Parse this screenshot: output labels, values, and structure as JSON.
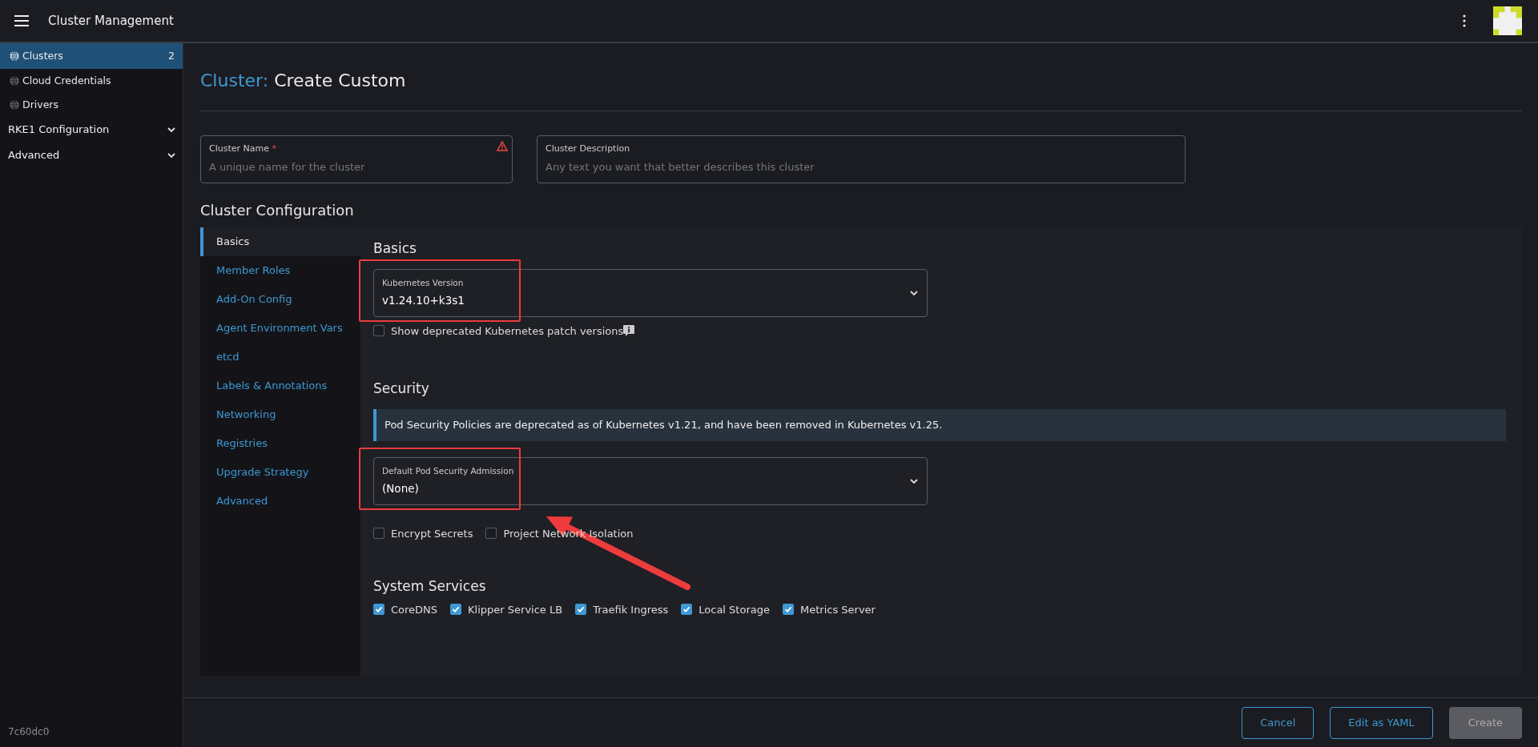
{
  "header": {
    "title": "Cluster Management"
  },
  "sidebar": {
    "items": [
      {
        "kind": "link",
        "label": "Clusters",
        "count": "2",
        "selected": true
      },
      {
        "kind": "link",
        "label": "Cloud Credentials",
        "selected": false
      },
      {
        "kind": "link",
        "label": "Drivers",
        "selected": false
      },
      {
        "kind": "group",
        "label": "RKE1 Configuration",
        "expanded": false
      },
      {
        "kind": "group",
        "label": "Advanced",
        "expanded": false
      }
    ],
    "version": "7c60dc0"
  },
  "page": {
    "title_prefix": "Cluster:",
    "title": "Create Custom"
  },
  "fields": [
    {
      "label": "Cluster Name",
      "required_mark": "*",
      "error": true,
      "placeholder": "A unique name for the cluster"
    },
    {
      "label": "Cluster Description",
      "error": false,
      "placeholder": "Any text you want that better describes this cluster"
    }
  ],
  "config": {
    "heading": "Cluster Configuration",
    "tabs": [
      {
        "label": "Basics",
        "selected": true
      },
      {
        "label": "Member Roles",
        "selected": false
      },
      {
        "label": "Add-On Config",
        "selected": false
      },
      {
        "label": "Agent Environment Vars",
        "selected": false
      },
      {
        "label": "etcd",
        "selected": false
      },
      {
        "label": "Labels & Annotations",
        "selected": false
      },
      {
        "label": "Networking",
        "selected": false
      },
      {
        "label": "Registries",
        "selected": false
      },
      {
        "label": "Upgrade Strategy",
        "selected": false
      },
      {
        "label": "Advanced",
        "selected": false
      }
    ],
    "basics": {
      "heading": "Basics",
      "version_select": {
        "label": "Kubernetes Version",
        "value": "v1.24.10+k3s1",
        "highlighted": true
      },
      "show_deprecated": {
        "label": "Show deprecated Kubernetes patch versions",
        "checked": false
      }
    },
    "security": {
      "heading": "Security",
      "banner": "Pod Security Policies are deprecated as of Kubernetes v1.21, and have been removed in Kubernetes v1.25.",
      "psa_select": {
        "label": "Default Pod Security Admission",
        "value": "(None)",
        "highlighted": true,
        "arrow": true
      },
      "options": [
        {
          "label": "Encrypt Secrets",
          "checked": false
        },
        {
          "label": "Project Network Isolation",
          "checked": false
        }
      ]
    },
    "system_services": {
      "heading": "System Services",
      "options": [
        {
          "label": "CoreDNS",
          "checked": true
        },
        {
          "label": "Klipper Service LB",
          "checked": true
        },
        {
          "label": "Traefik Ingress",
          "checked": true
        },
        {
          "label": "Local Storage",
          "checked": true
        },
        {
          "label": "Metrics Server",
          "checked": true
        }
      ]
    }
  },
  "footer": {
    "buttons": [
      {
        "label": "Cancel",
        "kind": "outline"
      },
      {
        "label": "Edit as YAML",
        "kind": "outline"
      },
      {
        "label": "Create",
        "kind": "disabled"
      }
    ]
  }
}
